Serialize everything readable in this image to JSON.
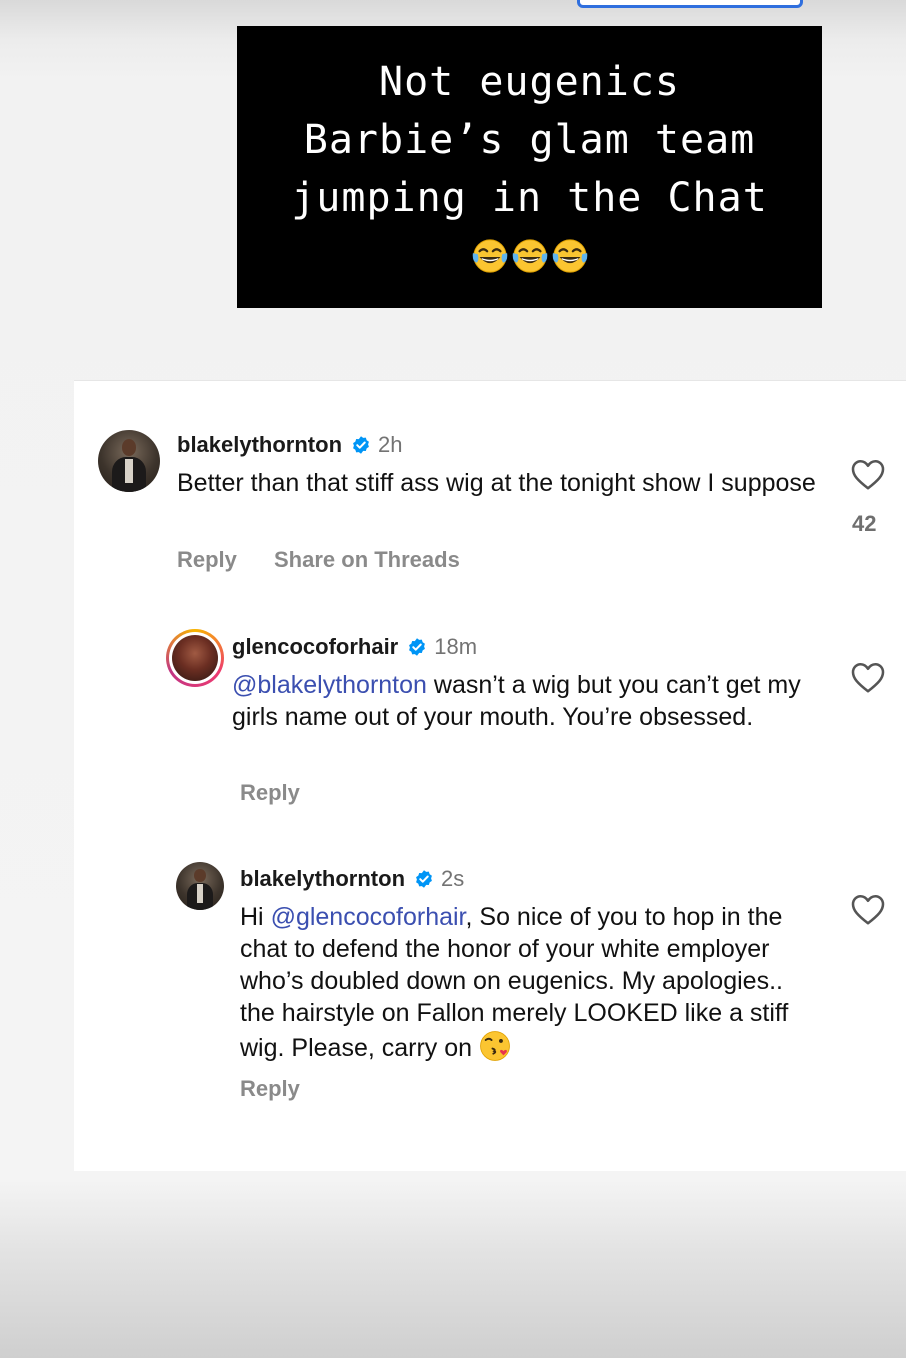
{
  "story_caption": {
    "lines": [
      "Not eugenics",
      "Barbie’s glam team",
      "jumping in the Chat"
    ],
    "emoji": "face-with-tears-of-joy"
  },
  "comments": [
    {
      "username": "blakelythornton",
      "time": "2h",
      "text": "Better than that stiff ass wig at the tonight show I suppose",
      "reply_label": "Reply",
      "share_label": "Share on Threads",
      "likes": "42"
    },
    {
      "username": "glencocoforhair",
      "time": "18m",
      "mention": "@blakelythornton",
      "text": " wasn’t a wig but you can’t get my girls name out of your mouth. You’re obsessed.",
      "reply_label": "Reply"
    },
    {
      "username": "blakelythornton",
      "time": "2s",
      "text_before": "Hi ",
      "mention": "@glencocoforhair",
      "text": ", So nice of you to hop in the chat to defend the honor of your white employer who’s doubled down on eugenics. My apologies.. the hairstyle on Fallon merely LOOKED like a stiff wig. Please, carry on",
      "emoji": "face-blowing-a-kiss",
      "reply_label": "Reply"
    }
  ],
  "colors": {
    "mention": "#3b4fb0",
    "verified_badge": "#0095f6",
    "secondary_text": "#737373"
  }
}
